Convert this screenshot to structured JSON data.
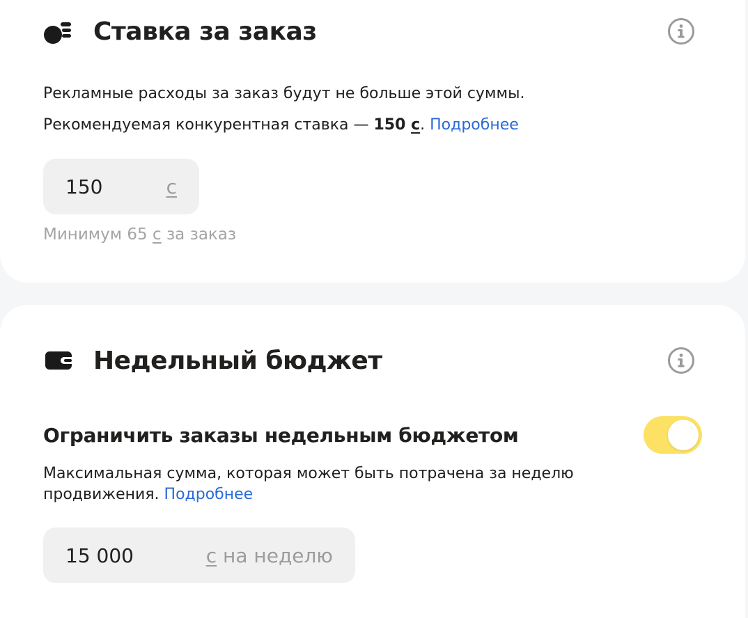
{
  "bid_section": {
    "title": "Ставка за заказ",
    "description": "Рекламные расходы за заказ будут не больше этой суммы.",
    "recommended_prefix": "Рекомендуемая конкурентная ставка — ",
    "recommended_value": "150 ",
    "recommended_currency": "с",
    "recommended_period": ".",
    "more_link": "Подробнее",
    "input_value": "150",
    "input_suffix": "с",
    "hint_prefix": "Минимум 65 ",
    "hint_currency": "с",
    "hint_suffix": " за заказ"
  },
  "budget_section": {
    "title": "Недельный бюджет",
    "toggle_label": "Ограничить заказы недельным бюджетом",
    "toggle_on": true,
    "description_line1": "Максимальная сумма, которая может быть потрачена за неделю",
    "description_line2": "продвижения. ",
    "more_link": "Подробнее",
    "input_value": "15 000",
    "input_suffix_currency": "с",
    "input_suffix_period": " на неделю"
  },
  "colors": {
    "link": "#2a6ad6",
    "toggle_active": "#fce164",
    "input_background": "#f0f0f1",
    "page_background": "#f5f6f8"
  },
  "icons": {
    "bid": "coins-icon",
    "budget": "wallet-icon",
    "info": "info-icon"
  }
}
